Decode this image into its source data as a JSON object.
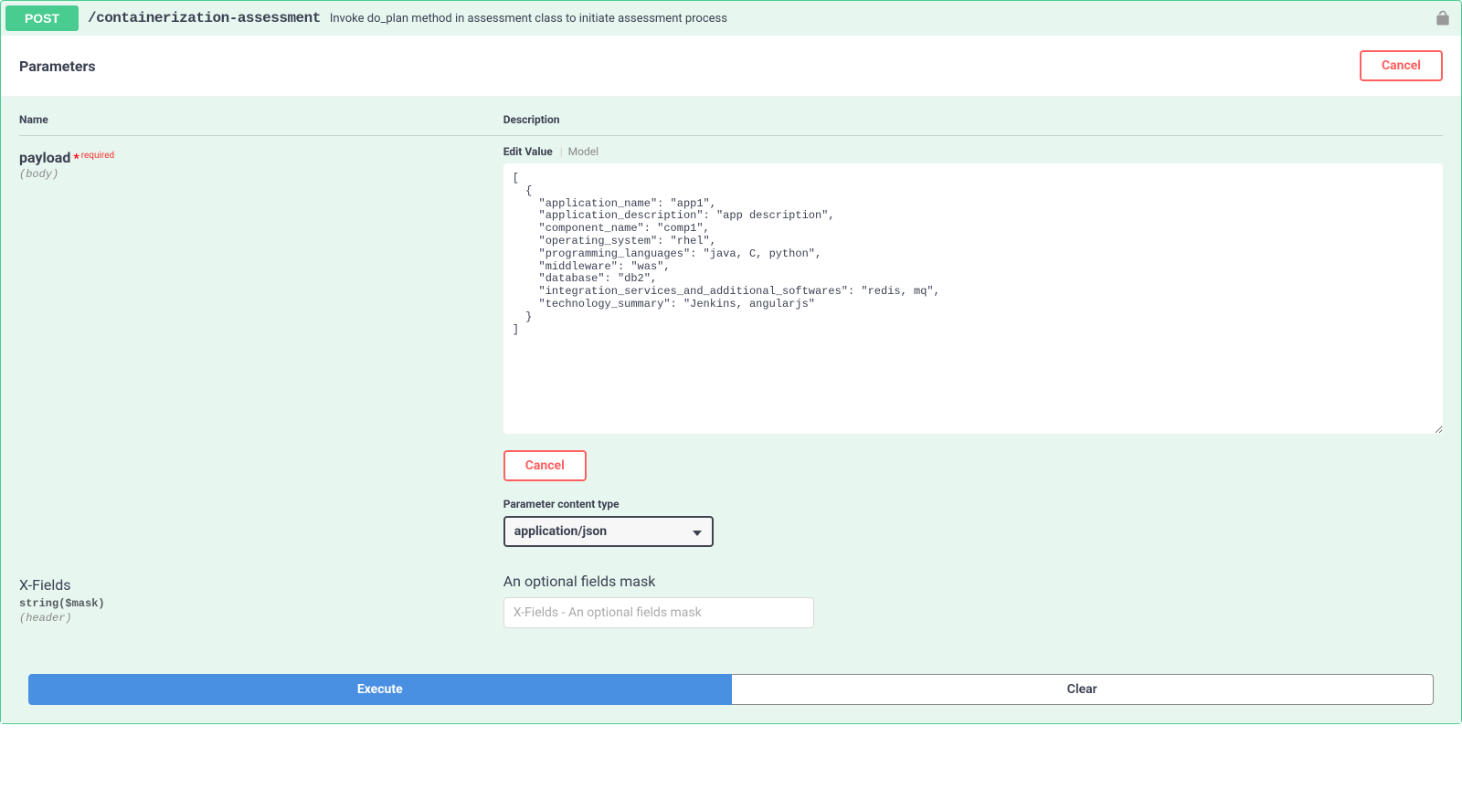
{
  "summary": {
    "method": "POST",
    "path": "/containerization-assessment",
    "description": "Invoke do_plan method in assessment class to initiate assessment process"
  },
  "parameters": {
    "title": "Parameters",
    "cancel_label": "Cancel",
    "columns": {
      "name": "Name",
      "description": "Description"
    }
  },
  "payload": {
    "name": "payload",
    "required_star": "*",
    "required_text": "required",
    "in": "(body)",
    "tabs": {
      "edit": "Edit Value",
      "divider": "|",
      "model": "Model"
    },
    "body_value": "[\n  {\n    \"application_name\": \"app1\",\n    \"application_description\": \"app description\",\n    \"component_name\": \"comp1\",\n    \"operating_system\": \"rhel\",\n    \"programming_languages\": \"java, C, python\",\n    \"middleware\": \"was\",\n    \"database\": \"db2\",\n    \"integration_services_and_additional_softwares\": \"redis, mq\",\n    \"technology_summary\": \"Jenkins, angularjs\"\n  }\n]",
    "cancel_label": "Cancel",
    "content_type_label": "Parameter content type",
    "content_type_value": "application/json"
  },
  "xfields": {
    "name": "X-Fields",
    "type": "string($mask)",
    "in": "(header)",
    "description": "An optional fields mask",
    "placeholder": "X-Fields - An optional fields mask"
  },
  "actions": {
    "execute": "Execute",
    "clear": "Clear"
  }
}
